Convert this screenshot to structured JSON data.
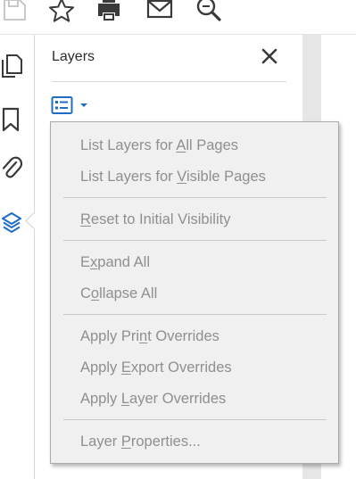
{
  "toolbar": {
    "icons": [
      "save-icon",
      "star-icon",
      "print-icon",
      "mail-icon",
      "search-zoom-icon"
    ]
  },
  "rail": {
    "icons": [
      "pages-icon",
      "bookmark-icon",
      "attachment-icon",
      "layers-icon"
    ],
    "active_icon": "layers-icon"
  },
  "panel": {
    "title": "Layers",
    "close_icon": "close-icon",
    "options_icon": "options-menu-icon"
  },
  "menu": {
    "items": [
      {
        "pre": "List Layers for ",
        "key": "A",
        "post": "ll Pages",
        "enabled": false
      },
      {
        "pre": "List Layers for ",
        "key": "V",
        "post": "isible Pages",
        "enabled": false
      },
      {
        "pre": "",
        "key": "R",
        "post": "eset to Initial Visibility",
        "enabled": false
      },
      {
        "pre": "E",
        "key": "x",
        "post": "pand All",
        "enabled": false
      },
      {
        "pre": "C",
        "key": "o",
        "post": "llapse All",
        "enabled": false
      },
      {
        "pre": "Apply Pri",
        "key": "n",
        "post": "t Overrides",
        "enabled": false
      },
      {
        "pre": "Apply ",
        "key": "E",
        "post": "xport Overrides",
        "enabled": false
      },
      {
        "pre": "Apply ",
        "key": "L",
        "post": "ayer Overrides",
        "enabled": false
      },
      {
        "pre": "Layer ",
        "key": "P",
        "post": "roperties...",
        "enabled": false
      }
    ]
  },
  "colors": {
    "accent": "#1f6dc2",
    "icon_dark": "#3a3a3a",
    "menu_bg": "#f0f0f0",
    "menu_text_disabled": "#8f8f8f"
  }
}
